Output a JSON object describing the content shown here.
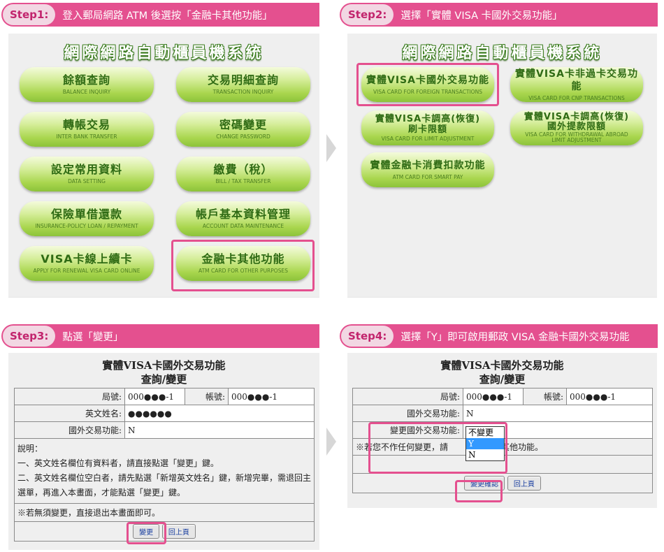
{
  "step1": {
    "badge": "Step1:",
    "title": "登入郵局網路 ATM 後選按「金融卡其他功能」",
    "panel_title": "網際網路自動櫃員機系統",
    "buttons": [
      {
        "zh": "餘額查詢",
        "en": "BALANCE INQUIRY"
      },
      {
        "zh": "交易明細查詢",
        "en": "TRANSACTION INQUIRY"
      },
      {
        "zh": "轉帳交易",
        "en": "INTER BANK TRANSFER"
      },
      {
        "zh": "密碼變更",
        "en": "CHANGE PASSWORD"
      },
      {
        "zh": "設定常用資料",
        "en": "DATA SETTING"
      },
      {
        "zh": "繳費（稅）",
        "en": "BILL / TAX TRANSFER"
      },
      {
        "zh": "保險單借還款",
        "en": "INSURANCE-POLICY LOAN / REPAYMENT"
      },
      {
        "zh": "帳戶基本資料管理",
        "en": "ACCOUNT DATA MAINTENANCE"
      },
      {
        "zh": "VISA卡線上續卡",
        "en": "APPLY FOR RENEWAL VISA CARD ONLINE"
      },
      {
        "zh": "金融卡其他功能",
        "en": "ATM CARD FOR OTHER PURPOSES"
      }
    ]
  },
  "step2": {
    "badge": "Step2:",
    "title": "選擇「實體 VISA 卡國外交易功能」",
    "panel_title": "網際網路自動櫃員機系統",
    "buttons": [
      {
        "zh": "實體VISA卡國外交易功能",
        "en": "VISA CARD FOR FOREIGN TRANSACTIONS"
      },
      {
        "zh": "實體VISA卡非過卡交易功能",
        "en": "VISA CARD FOR CNP TRANSACTIONS"
      },
      {
        "zh": "實體VISA卡調高(恢復)",
        "zh2": "刷卡限額",
        "en": "VISA CARD FOR LIMIT ADJUSTMENT"
      },
      {
        "zh": "實體VISA卡調高(恢復)",
        "zh2": "國外提款限額",
        "en": "VISA CARD FOR WITHDRAWAL ABROAD",
        "en2": "LIMIT ADJUSTMENT"
      },
      {
        "zh": "實體金融卡消費扣款功能",
        "en": "ATM CARD FOR SMART PAY"
      }
    ]
  },
  "step3": {
    "badge": "Step3:",
    "title": "點選「變更」",
    "form_title1": "實體VISA卡國外交易功能",
    "form_title2": "查詢/變更",
    "branch_label": "局號:",
    "branch_value": "000●●●-1",
    "account_label": "帳號:",
    "account_value": "000●●●-1",
    "name_label": "英文姓名:",
    "name_value": "●●●●●●",
    "foreign_label": "國外交易功能:",
    "foreign_value": "N",
    "notes_title": "說明：",
    "note1": "一、英文姓名欄位有資料者，請直接點選「變更」鍵。",
    "note2": "二、英文姓名欄位空白者，請先點選「新增英文姓名」鍵，新增完畢，需退回主選單，再進入本畫面，才能點選「變更」鍵。",
    "note3": "※若無須變更，直接退出本畫面即可。",
    "change_btn": "變更",
    "back_btn": "回上頁"
  },
  "step4": {
    "badge": "Step4:",
    "title": "選擇「Y」即可啟用郵政 VISA 金融卡國外交易功能",
    "form_title1": "實體VISA卡國外交易功能",
    "form_title2": "查詢/變更",
    "branch_label": "局號:",
    "branch_value": "000●●●-1",
    "account_label": "帳號:",
    "account_value": "000●●●-1",
    "foreign_label": "國外交易功能:",
    "foreign_value": "N",
    "change_label": "變更國外交易功能:",
    "dropdown_options": [
      "不變更",
      "Y",
      "N"
    ],
    "note_prefix": "※若您不作任何變更，請",
    "note_suffix": "頁其他功能。",
    "confirm_btn": "變更確認",
    "back_btn": "回上頁"
  },
  "colors": {
    "accent": "#e4508f",
    "button_green": "#a9d64e",
    "dropdown_selected": "#3399ff"
  }
}
